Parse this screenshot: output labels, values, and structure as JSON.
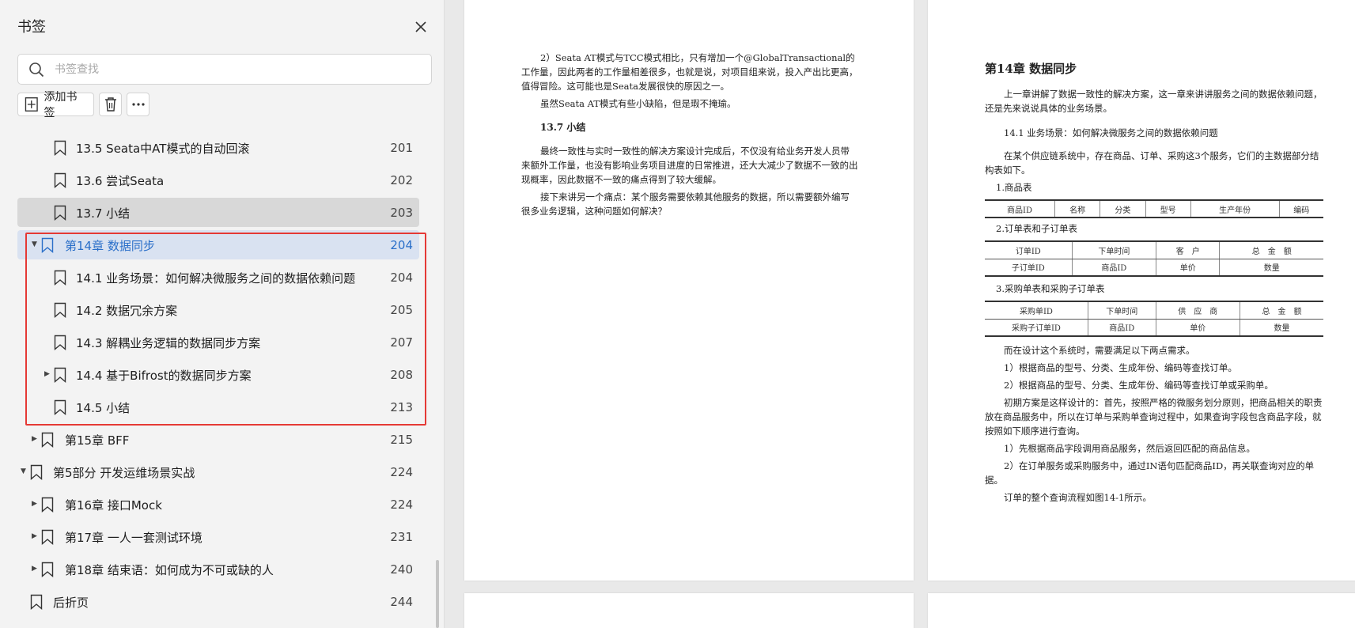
{
  "sidebar": {
    "title": "书签",
    "search_placeholder": "书签查找",
    "add_bookmark_label": "添加书签",
    "items": [
      {
        "label": "13.5 Seata中AT模式的自动回滚",
        "page": "201"
      },
      {
        "label": "13.6 尝试Seata",
        "page": "202"
      },
      {
        "label": "13.7 小结",
        "page": "203"
      },
      {
        "label": "第14章 数据同步",
        "page": "204"
      },
      {
        "label": "14.1 业务场景：如何解决微服务之间的数据依赖问题",
        "page": "204"
      },
      {
        "label": "14.2 数据冗余方案",
        "page": "205"
      },
      {
        "label": "14.3 解耦业务逻辑的数据同步方案",
        "page": "207"
      },
      {
        "label": "14.4 基于Bifrost的数据同步方案",
        "page": "208"
      },
      {
        "label": "14.5 小结",
        "page": "213"
      },
      {
        "label": "第15章 BFF",
        "page": "215"
      },
      {
        "label": "第5部分 开发运维场景实战",
        "page": "224"
      },
      {
        "label": "第16章 接口Mock",
        "page": "224"
      },
      {
        "label": "第17章 一人一套测试环境",
        "page": "231"
      },
      {
        "label": "第18章 结束语：如何成为不可或缺的人",
        "page": "240"
      },
      {
        "label": "后折页",
        "page": "244"
      }
    ]
  },
  "page_left": {
    "para1": "2）Seata AT模式与TCC模式相比，只有增加一个@GlobalTransactional的工作量，因此两者的工作量相差很多，也就是说，对项目组来说，投入产出比更高，值得冒险。这可能也是Seata发展很快的原因之一。",
    "para2": "虽然Seata AT模式有些小缺陷，但是瑕不掩瑜。",
    "heading": "13.7 小结",
    "para3": "最终一致性与实时一致性的解决方案设计完成后，不仅没有给业务开发人员带来额外工作量，也没有影响业务项目进度的日常推进，还大大减少了数据不一致的出现概率，因此数据不一致的痛点得到了较大缓解。",
    "para4": "接下来讲另一个痛点：某个服务需要依赖其他服务的数据，所以需要额外编写很多业务逻辑，这种问题如何解决？"
  },
  "page_right": {
    "chapter_title": "第14章 数据同步",
    "intro": "上一章讲解了数据一致性的解决方案，这一章来讲讲服务之间的数据依赖问题，还是先来说说具体的业务场景。",
    "section_heading": "14.1 业务场景：如何解决微服务之间的数据依赖问题",
    "para1": "在某个供应链系统中，存在商品、订单、采购这3个服务，它们的主数据部分结构表如下。",
    "t1_title": "1.商品表",
    "t1_cols": [
      "商品ID",
      "名称",
      "分类",
      "型号",
      "生产年份",
      "编码"
    ],
    "t2_title": "2.订单表和子订单表",
    "t2_rows": [
      [
        "订单ID",
        "下单时间",
        "客　户",
        "总　金　额"
      ],
      [
        "子订单ID",
        "商品ID",
        "单价",
        "数量"
      ]
    ],
    "t3_title": "3.采购单表和采购子订单表",
    "t3_rows": [
      [
        "采购单ID",
        "下单时间",
        "供　应　商",
        "总　金　额"
      ],
      [
        "采购子订单ID",
        "商品ID",
        "单价",
        "数量"
      ]
    ],
    "para2": "而在设计这个系统时，需要满足以下两点需求。",
    "para3": "1）根据商品的型号、分类、生成年份、编码等查找订单。",
    "para4": "2）根据商品的型号、分类、生成年份、编码等查找订单或采购单。",
    "para5": "初期方案是这样设计的：首先，按照严格的微服务划分原则，把商品相关的职责放在商品服务中，所以在订单与采购单查询过程中，如果查询字段包含商品字段，就按照如下顺序进行查询。",
    "para6": "1）先根据商品字段调用商品服务，然后返回匹配的商品信息。",
    "para7": "2）在订单服务或采购服务中，通过IN语句匹配商品ID，再关联查询对应的单据。",
    "para8": "订单的整个查询流程如图14-1所示。"
  },
  "colors": {
    "selection_bg": "#d9e2f1",
    "selection_text": "#2a6fc9",
    "highlight_border": "#e53935"
  }
}
